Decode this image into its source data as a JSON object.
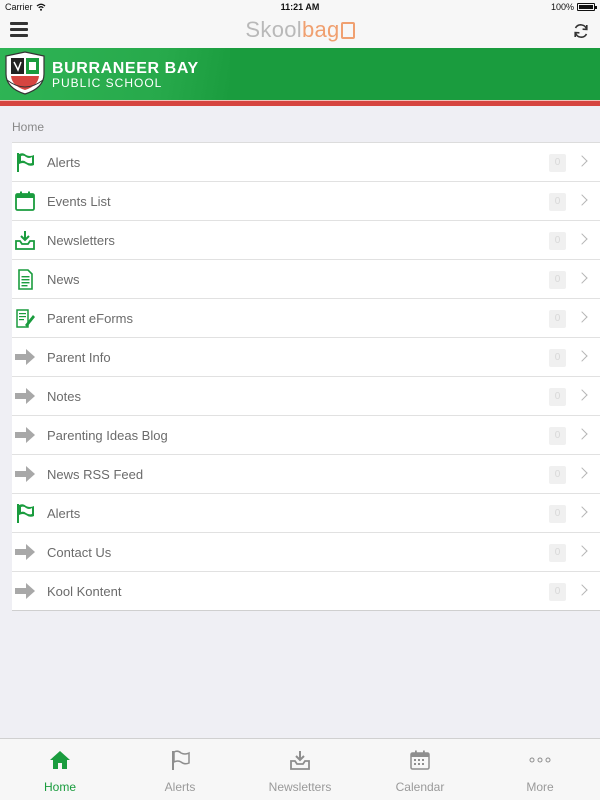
{
  "status_bar": {
    "carrier": "Carrier",
    "time": "11:21 AM",
    "battery": "100%",
    "battery_level": 1.0
  },
  "navbar": {
    "brand_part1": "Skool",
    "brand_part2": "bag"
  },
  "banner": {
    "school_name": "BURRANEER BAY",
    "school_sub": "PUBLIC SCHOOL"
  },
  "breadcrumb": "Home",
  "menu": {
    "items": [
      {
        "label": "Alerts",
        "icon": "flag-icon",
        "count": "0"
      },
      {
        "label": "Events List",
        "icon": "calendar-icon",
        "count": "0"
      },
      {
        "label": "Newsletters",
        "icon": "inbox-download-icon",
        "count": "0"
      },
      {
        "label": "News",
        "icon": "document-icon",
        "count": "0"
      },
      {
        "label": "Parent eForms",
        "icon": "form-edit-icon",
        "count": "0"
      },
      {
        "label": "Parent Info",
        "icon": "arrow-right-icon",
        "count": "0"
      },
      {
        "label": "Notes",
        "icon": "arrow-right-icon",
        "count": "0"
      },
      {
        "label": "Parenting Ideas Blog",
        "icon": "arrow-right-icon",
        "count": "0"
      },
      {
        "label": "News RSS Feed",
        "icon": "arrow-right-icon",
        "count": "0"
      },
      {
        "label": "Alerts",
        "icon": "flag-icon",
        "count": "0"
      },
      {
        "label": "Contact Us",
        "icon": "arrow-right-icon",
        "count": "0"
      },
      {
        "label": "Kool Kontent",
        "icon": "arrow-right-icon",
        "count": "0"
      }
    ]
  },
  "tabbar": {
    "tabs": [
      {
        "label": "Home",
        "icon": "home-icon",
        "active": true
      },
      {
        "label": "Alerts",
        "icon": "flag-icon",
        "active": false
      },
      {
        "label": "Newsletters",
        "icon": "inbox-download-icon",
        "active": false
      },
      {
        "label": "Calendar",
        "icon": "calendar-icon",
        "active": false
      },
      {
        "label": "More",
        "icon": "more-dots-icon",
        "active": false
      }
    ]
  },
  "colors": {
    "brand_green": "#1a9c3e",
    "accent_red": "#d64540",
    "brand_orange": "#f0a070",
    "badge_bg": "#f0f0f0"
  }
}
